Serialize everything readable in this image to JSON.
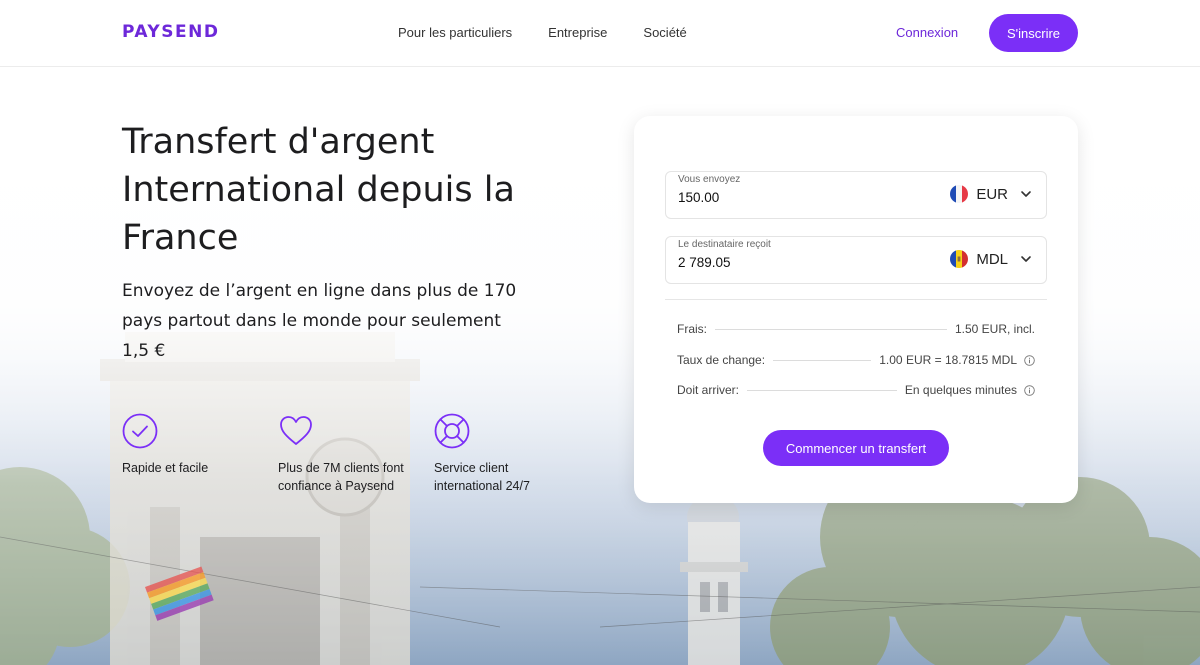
{
  "header": {
    "logo": "PAYSEND",
    "nav": [
      "Pour les particuliers",
      "Entreprise",
      "Société"
    ],
    "login": "Connexion",
    "signup": "S'inscrire"
  },
  "hero": {
    "title": "Transfert d'argent International depuis la France",
    "subtitle": "Envoyez de l’argent en ligne dans plus de 170 pays partout dans le monde pour seulement 1,5 €",
    "features": [
      {
        "icon": "checkmark-circle-icon",
        "label": "Rapide et facile"
      },
      {
        "icon": "heart-icon",
        "label": "Plus de 7M clients font confiance à Paysend"
      },
      {
        "icon": "lifebuoy-icon",
        "label": "Service client international 24/7"
      }
    ]
  },
  "converter": {
    "send": {
      "label": "Vous envoyez",
      "value": "150.00",
      "currency": "EUR",
      "flag": "france-flag-icon"
    },
    "receive": {
      "label": "Le destinataire reçoit",
      "value": "2 789.05",
      "currency": "MDL",
      "flag": "moldova-flag-icon"
    },
    "fees": {
      "label": "Frais:",
      "value": "1.50 EUR, incl."
    },
    "rate": {
      "label": "Taux de change:",
      "value": "1.00 EUR = 18.7815 MDL"
    },
    "arrival": {
      "label": "Doit arriver:",
      "value": "En quelques minutes"
    },
    "cta": "Commencer un transfert"
  },
  "colors": {
    "brand": "#7b2ff7",
    "logo": "#6d28d9",
    "text": "#1d1d1f"
  }
}
